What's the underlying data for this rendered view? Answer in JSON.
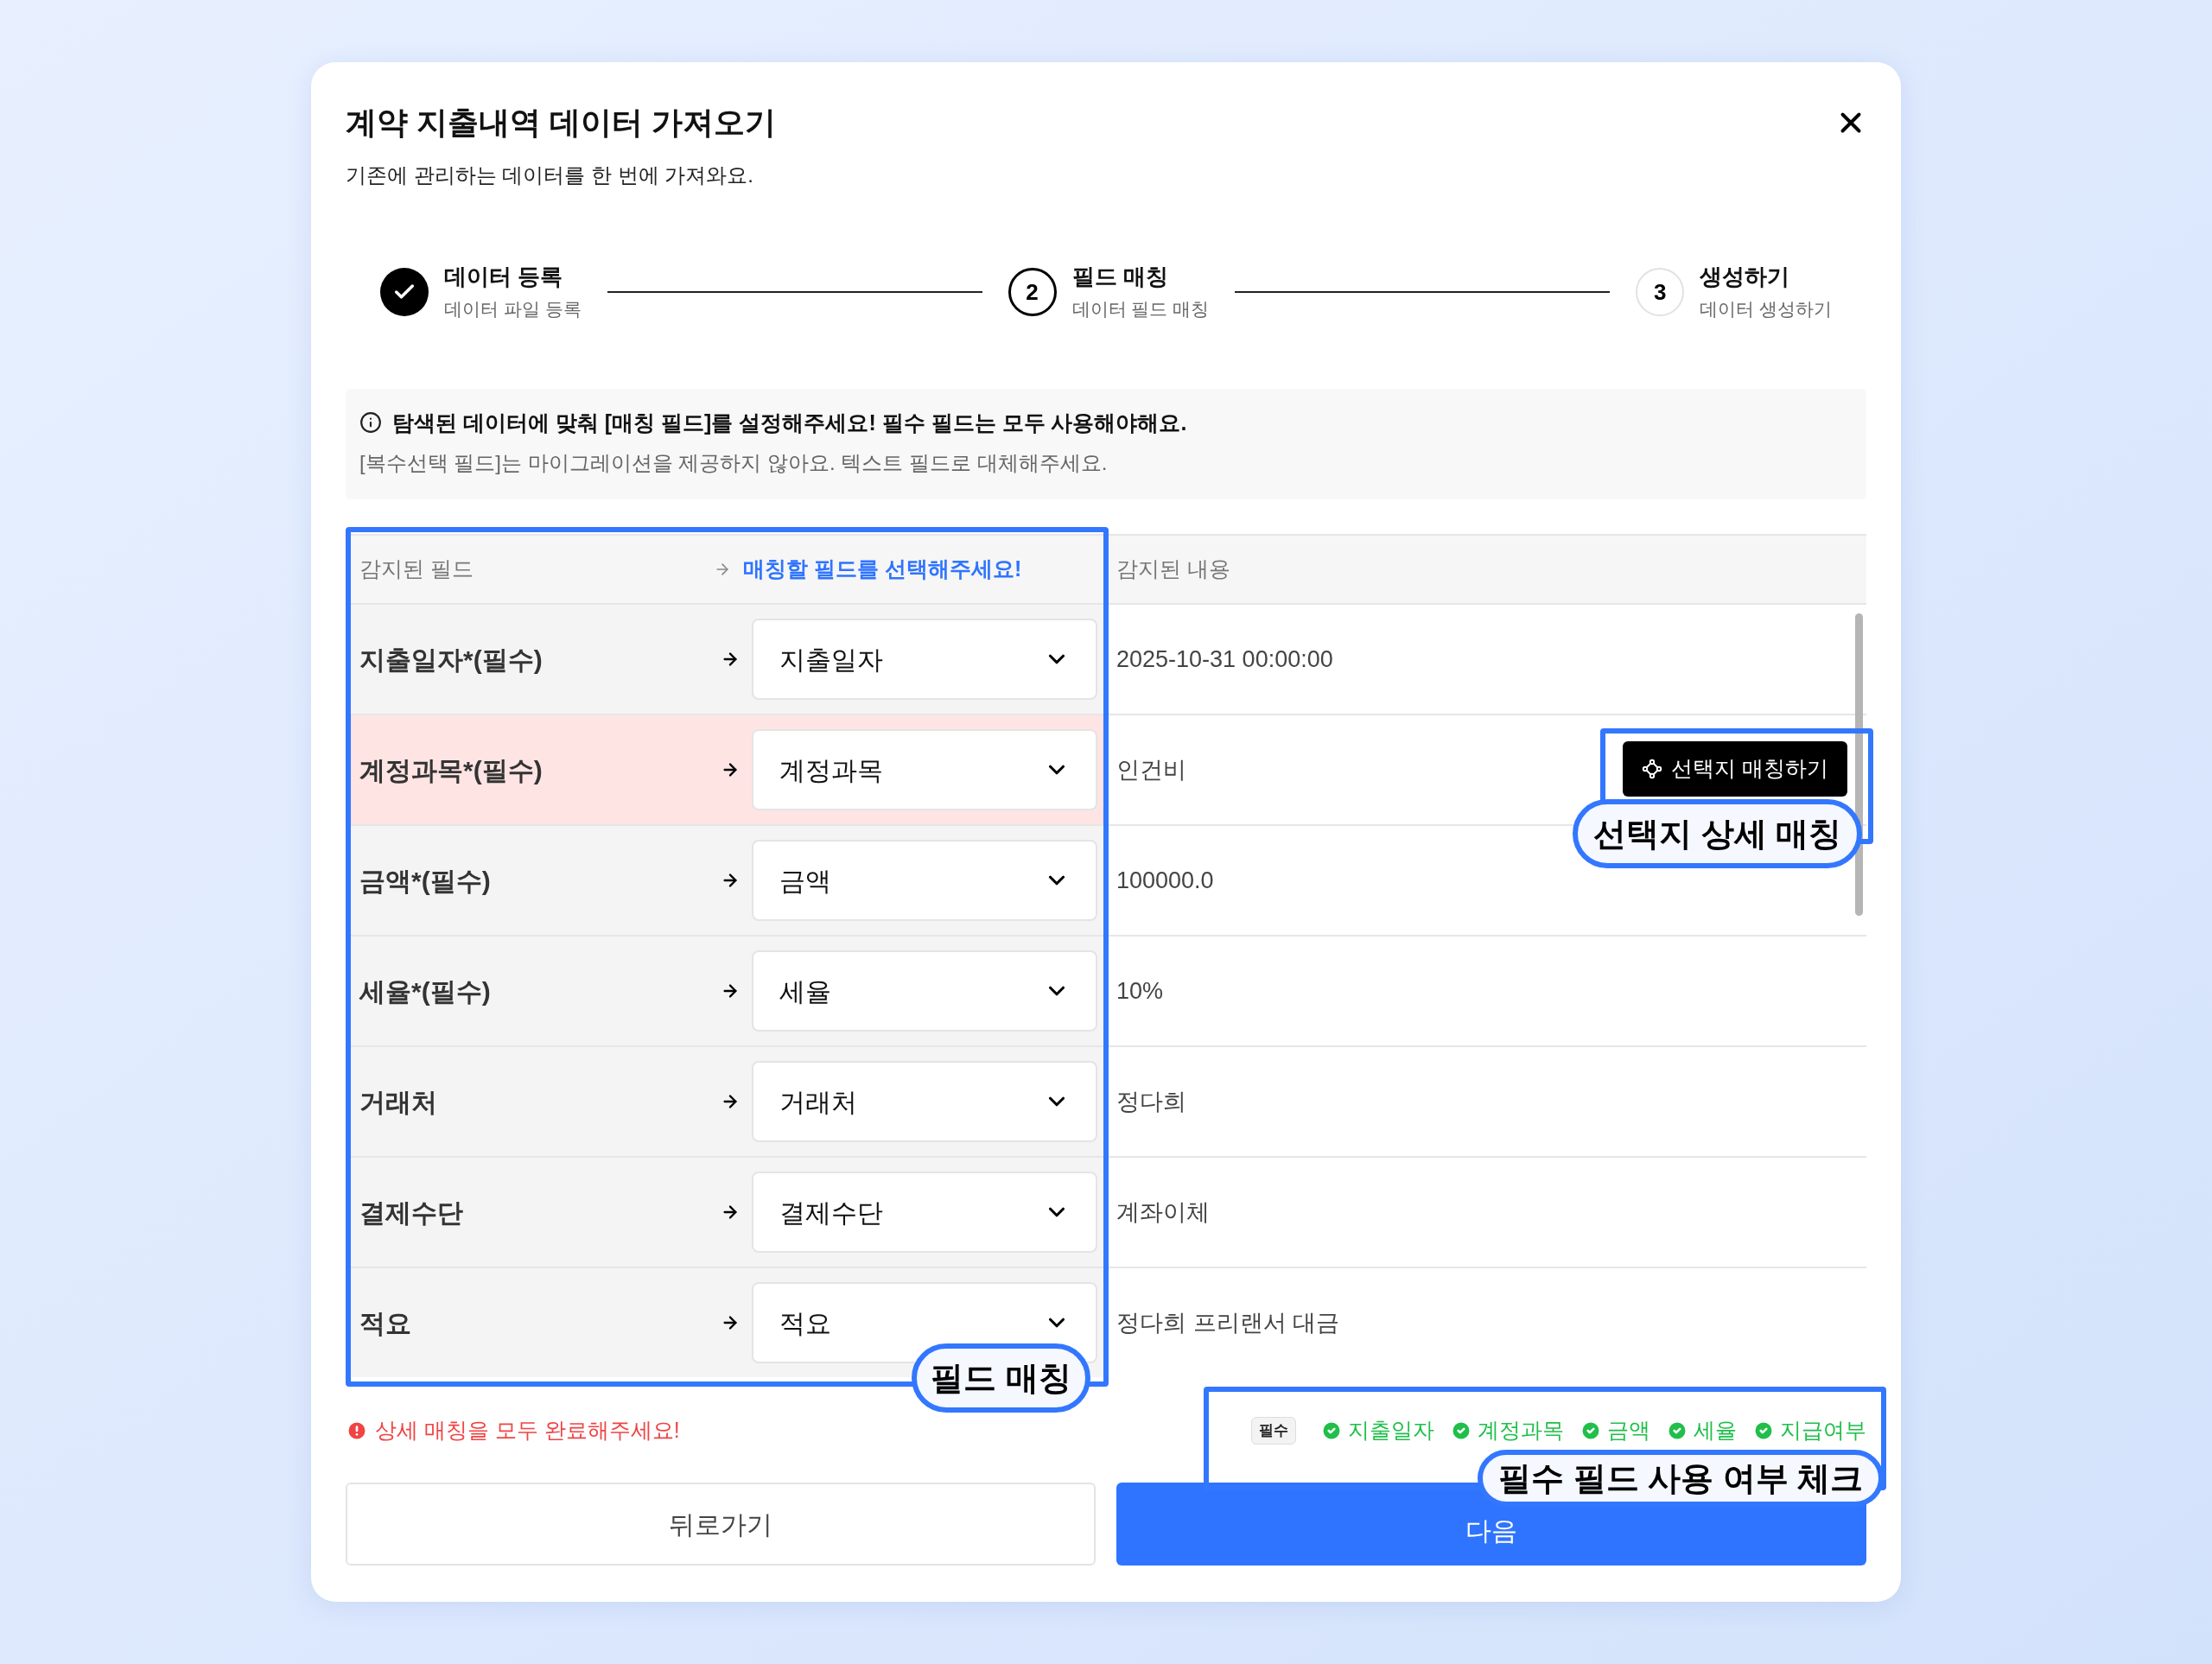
{
  "dialog": {
    "title": "계약 지출내역 데이터 가져오기",
    "subtitle": "기존에 관리하는 데이터를 한 번에 가져와요."
  },
  "steps": [
    {
      "kind": "done",
      "label": "데이터 등록",
      "sublabel": "데이터 파일 등록"
    },
    {
      "kind": "current",
      "number": "2",
      "label": "필드 매칭",
      "sublabel": "데이터 필드 매칭"
    },
    {
      "kind": "upcoming",
      "number": "3",
      "label": "생성하기",
      "sublabel": "데이터 생성하기"
    }
  ],
  "notice": {
    "headline": "탐색된 데이터에 맞춰 [매칭 필드]를 설정해주세요! 필수 필드는 모두 사용해야해요.",
    "detail": "[복수선택 필드]는 마이그레이션을 제공하지 않아요. 텍스트 필드로 대체해주세요."
  },
  "table": {
    "columns": [
      "감지된 필드",
      "매칭할 필드를 선택해주세요!",
      "감지된 내용"
    ],
    "rows": [
      {
        "field": "지출일자*(필수)",
        "match": "지출일자",
        "content": "2025-10-31 00:00:00",
        "highlighted": false
      },
      {
        "field": "계정과목*(필수)",
        "match": "계정과목",
        "content": "인건비",
        "highlighted": true,
        "action": "선택지 매칭하기"
      },
      {
        "field": "금액*(필수)",
        "match": "금액",
        "content": "100000.0",
        "highlighted": false
      },
      {
        "field": "세율*(필수)",
        "match": "세율",
        "content": "10%",
        "highlighted": false
      },
      {
        "field": "거래처",
        "match": "거래처",
        "content": "정다희",
        "highlighted": false
      },
      {
        "field": "결제수단",
        "match": "결제수단",
        "content": "계좌이체",
        "highlighted": false
      },
      {
        "field": "적요",
        "match": "적요",
        "content": "정다희 프리랜서 대금",
        "highlighted": false
      }
    ]
  },
  "error": "상세 매칭을 모두 완료해주세요!",
  "required_check": {
    "badge": "필수",
    "items": [
      {
        "label": "지출일자",
        "checked": true
      },
      {
        "label": "계정과목",
        "checked": true
      },
      {
        "label": "금액",
        "checked": true
      },
      {
        "label": "세율",
        "checked": true
      },
      {
        "label": "지급여부",
        "checked": true
      }
    ]
  },
  "buttons": {
    "back": "뒤로가기",
    "next": "다음"
  },
  "annotations": [
    "필드 매칭",
    "선택지 상세 매칭",
    "필수 필드 사용 여부 체크"
  ]
}
